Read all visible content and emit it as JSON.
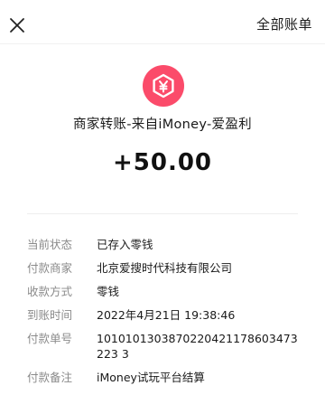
{
  "header": {
    "close_icon": "close-icon",
    "all_bills_label": "全部账单"
  },
  "merchant": {
    "logo_icon": "yuan-hexagon-icon",
    "logo_color": "#fb4b6a",
    "title": "商家转账-来自iMoney-爱盈利"
  },
  "amount": "+50.00",
  "details": [
    {
      "label": "当前状态",
      "value": "已存入零钱"
    },
    {
      "label": "付款商家",
      "value": "北京爱搜时代科技有限公司"
    },
    {
      "label": "收款方式",
      "value": "零钱"
    },
    {
      "label": "到账时间",
      "value": "2022年4月21日 19:38:46"
    },
    {
      "label": "付款单号",
      "value": "1010101303870220421178603473223 3"
    },
    {
      "label": "付款备注",
      "value": "iMoney试玩平台结算"
    }
  ]
}
